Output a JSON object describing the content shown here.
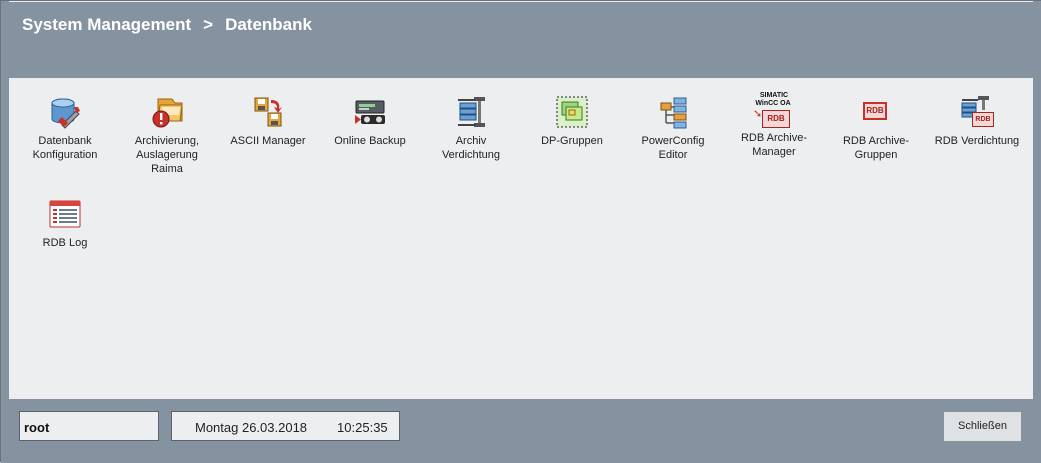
{
  "breadcrumb": {
    "root": "System Management",
    "separator": ">",
    "current": "Datenbank"
  },
  "tiles": [
    {
      "label": "Datenbank\nKonfiguration",
      "icon": "database-config-icon"
    },
    {
      "label": "Archivierung,\nAuslagerung\nRaima",
      "icon": "archive-folder-icon"
    },
    {
      "label": "ASCII Manager",
      "icon": "ascii-manager-icon"
    },
    {
      "label": "Online Backup",
      "icon": "online-backup-icon"
    },
    {
      "label": "Archiv\nVerdichtung",
      "icon": "archive-compression-icon"
    },
    {
      "label": "DP-Gruppen",
      "icon": "dp-groups-icon"
    },
    {
      "label": "PowerConfig\nEditor",
      "icon": "powerconfig-editor-icon"
    },
    {
      "label": "RDB Archive-\nManager",
      "icon": "rdb-archive-manager-icon",
      "badge_top": "SIMATIC",
      "badge_mid": "WinCC OA",
      "badge_rdb": "RDB"
    },
    {
      "label": "RDB Archive-\nGruppen",
      "icon": "rdb-archive-groups-icon",
      "badge_rdb": "RDB"
    },
    {
      "label": "RDB Verdichtung",
      "icon": "rdb-compression-icon",
      "badge_rdb": "RDB"
    },
    {
      "label": "RDB Log",
      "icon": "rdb-log-icon"
    }
  ],
  "footer": {
    "user": "root",
    "date": "Montag 26.03.2018",
    "time": "10:25:35",
    "close_label": "Schließen"
  },
  "colors": {
    "header": "#8592a0",
    "content": "#eceef0",
    "accent_red": "#c8302c"
  }
}
